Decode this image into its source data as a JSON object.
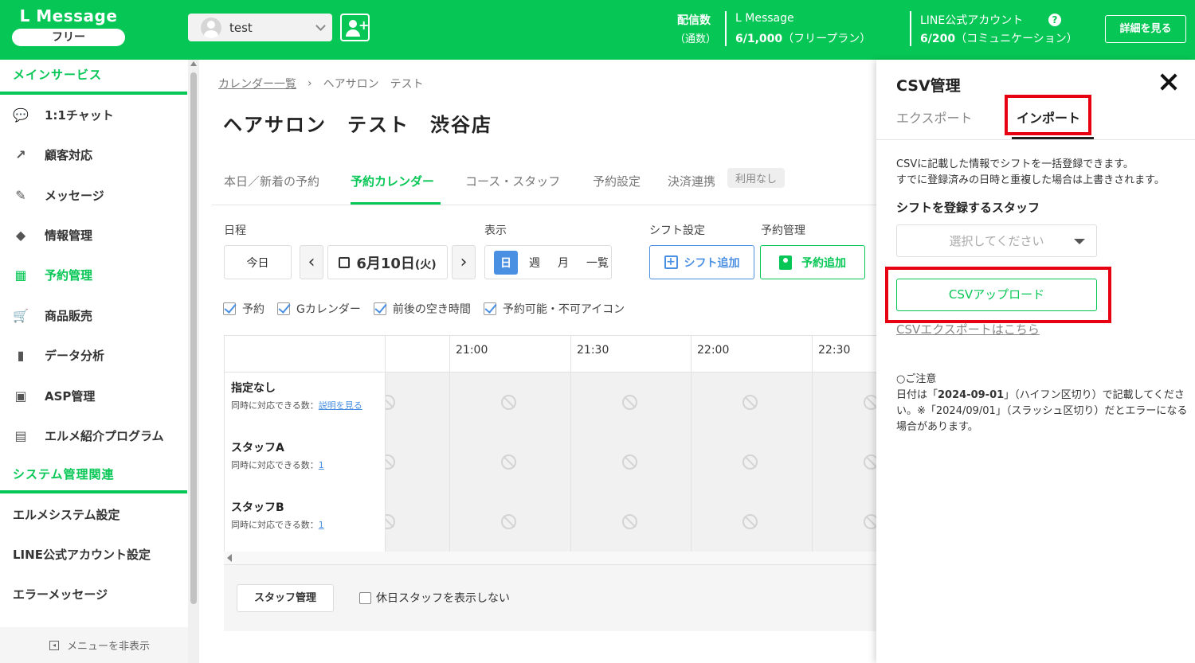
{
  "header": {
    "brand": "L Message",
    "plan_badge": "フリー",
    "account_name": "test",
    "stat1_label": "配信数",
    "stat1_sub": "（通数）",
    "stat2_name": "L Message",
    "stat2_value": "6/1,000",
    "stat2_plan": "（フリープラン）",
    "stat3_name": "LINE公式アカウント",
    "stat3_value": "6/200",
    "stat3_plan": "（コミュニケーション）",
    "help_glyph": "?",
    "detail_button": "詳細を見る"
  },
  "sidebar": {
    "section_main": "メインサービス",
    "items": [
      {
        "label": "1:1チャット",
        "icon": "chat-icon",
        "glyph": "💬"
      },
      {
        "label": "顧客対応",
        "icon": "arrow-icon",
        "glyph": "↗"
      },
      {
        "label": "メッセージ",
        "icon": "edit-icon",
        "glyph": "✎"
      },
      {
        "label": "情報管理",
        "icon": "tag-icon",
        "glyph": "◆"
      },
      {
        "label": "予約管理",
        "icon": "calendar-icon",
        "glyph": "▦"
      },
      {
        "label": "商品販売",
        "icon": "cart-icon",
        "glyph": "🛒"
      },
      {
        "label": "データ分析",
        "icon": "chart-icon",
        "glyph": "▮"
      },
      {
        "label": "ASP管理",
        "icon": "wallet-icon",
        "glyph": "▣"
      },
      {
        "label": "エルメ紹介プログラム",
        "icon": "clipboard-icon",
        "glyph": "▤"
      }
    ],
    "section_system": "システム管理関連",
    "system_items": [
      "エルメシステム設定",
      "LINE公式アカウント設定",
      "エラーメッセージ"
    ],
    "hide_menu": "メニューを非表示"
  },
  "main": {
    "breadcrumb": {
      "link": "カレンダー一覧",
      "sep": "›",
      "current": "ヘアサロン　テスト"
    },
    "title": "ヘアサロン　テスト　渋谷店",
    "tabs": [
      "本日／新着の予約",
      "予約カレンダー",
      "コース・スタッフ",
      "予約設定",
      "決済連携"
    ],
    "tab_badge": "利用なし",
    "schedule_label": "日程",
    "today_button": "今日",
    "prev": "‹",
    "next": "›",
    "date_main": "6月10日",
    "date_day": "(火)",
    "view_label": "表示",
    "view_day": "日",
    "view_week": "週",
    "view_month": "月",
    "view_list": "一覧",
    "shift_label": "シフト設定",
    "shift_button": "シフト追加",
    "resv_label": "予約管理",
    "resv_button": "予約追加",
    "checks": [
      "予約",
      "Gカレンダー",
      "前後の空き時間",
      "予約可能・不可アイコン"
    ],
    "times": [
      "21:00",
      "21:30",
      "22:00",
      "22:30"
    ],
    "staff": [
      {
        "name": "指定なし",
        "cap_label": "同時に対応できる数：",
        "cap_value": "説明を見る"
      },
      {
        "name": "スタッフA",
        "cap_label": "同時に対応できる数：",
        "cap_value": "1"
      },
      {
        "name": "スタッフB",
        "cap_label": "同時に対応できる数：",
        "cap_value": "1"
      }
    ],
    "staff_mgmt": "スタッフ管理",
    "hide_holiday": "休日スタッフを表示しない"
  },
  "drawer": {
    "title": "CSV管理",
    "tab_export": "エクスポート",
    "tab_import": "インポート",
    "desc1": "CSVに記載した情報でシフトを一括登録できます。",
    "desc2": "すでに登録済みの日時と重複した場合は上書きされます。",
    "staff_label": "シフトを登録するスタッフ",
    "select_placeholder": "選択してください",
    "upload_button": "CSVアップロード",
    "export_link": "CSVエクスポートはこちら",
    "note_title": "○ご注意",
    "note_pre": "日付は「",
    "note_bold": "2024-09-01",
    "note_post": "」（ハイフン区切り）で記載してください。※「2024/09/01」（スラッシュ区切り）だとエラーになる場合があります。"
  },
  "colors": {
    "brand": "#06c755",
    "highlight": "#e60012",
    "accent_blue": "#4a90e2"
  }
}
